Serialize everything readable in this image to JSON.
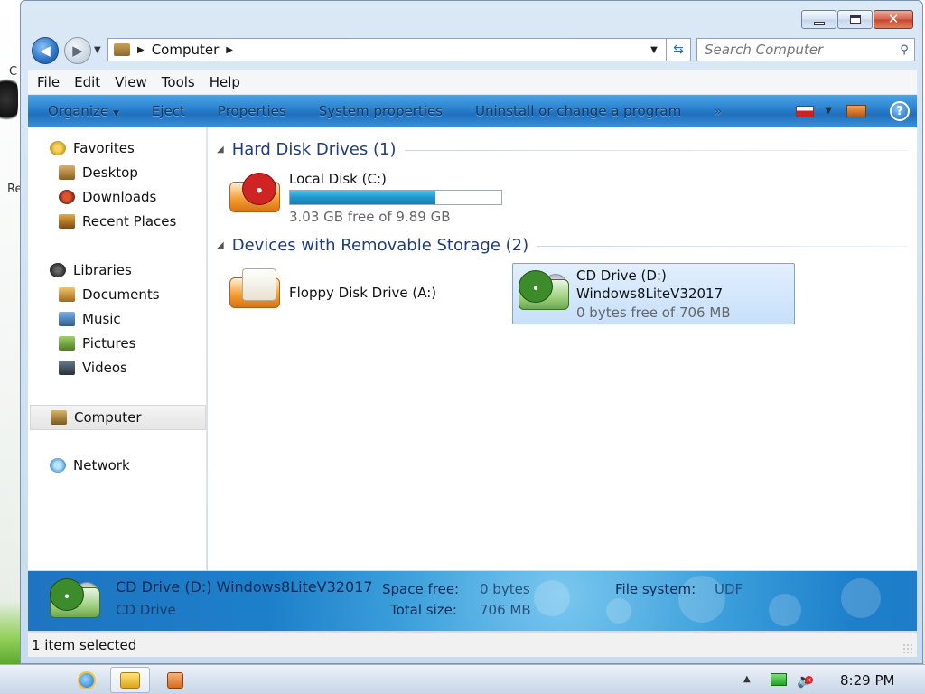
{
  "desktop": {
    "fragment_text_top": "C",
    "fragment_text": "Re"
  },
  "window": {
    "caption": {
      "minimize_icon": "minimize-icon",
      "maximize_icon": "maximize-icon",
      "close_glyph": "✕"
    }
  },
  "address_bar": {
    "crumbs": [
      "Computer"
    ],
    "back_icon": "back-arrow-icon",
    "forward_icon": "forward-arrow-icon"
  },
  "search": {
    "placeholder": "Search Computer"
  },
  "menu": {
    "items": [
      "File",
      "Edit",
      "View",
      "Tools",
      "Help"
    ]
  },
  "command_bar": {
    "organize": "Organize",
    "eject": "Eject",
    "properties": "Properties",
    "system_properties": "System properties",
    "uninstall": "Uninstall or change a program",
    "more": "»",
    "help": "?"
  },
  "nav_pane": {
    "favorites": {
      "label": "Favorites",
      "items": [
        "Desktop",
        "Downloads",
        "Recent Places"
      ]
    },
    "libraries": {
      "label": "Libraries",
      "items": [
        "Documents",
        "Music",
        "Pictures",
        "Videos"
      ]
    },
    "computer": "Computer",
    "network": "Network"
  },
  "groups": {
    "hdd": {
      "title": "Hard Disk Drives (1)",
      "drives": [
        {
          "name": "Local Disk (C:)",
          "free_text": "3.03 GB free of 9.89 GB",
          "used_fraction": 0.69
        }
      ]
    },
    "removable": {
      "title": "Devices with Removable Storage (2)",
      "drives": [
        {
          "name": "Floppy Disk Drive (A:)"
        },
        {
          "name": "CD Drive (D:)",
          "label": "Windows8LiteV32017",
          "free_text": "0 bytes free of 706 MB"
        }
      ]
    }
  },
  "details": {
    "title": "CD Drive (D:) Windows8LiteV32017",
    "type": "CD Drive",
    "space_free_label": "Space free:",
    "space_free_value": "0 bytes",
    "total_size_label": "Total size:",
    "total_size_value": "706 MB",
    "fs_label": "File system:",
    "fs_value": "UDF"
  },
  "status": {
    "text": "1 item selected"
  },
  "taskbar": {
    "clock": "8:29 PM"
  }
}
